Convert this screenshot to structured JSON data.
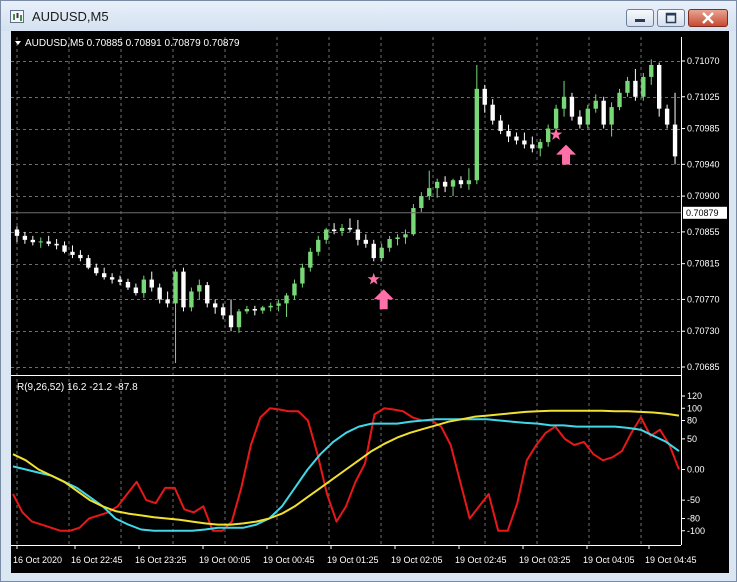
{
  "window": {
    "title": "AUDUSD,M5"
  },
  "main_chart": {
    "header": "AUDUSD,M5  0.70885 0.70891 0.70879 0.70879",
    "price_labels": [
      "0.71070",
      "0.71025",
      "0.70985",
      "0.70940",
      "0.70900",
      "0.70855",
      "0.70815",
      "0.70770",
      "0.70730",
      "0.70685"
    ],
    "current_price": "0.70879"
  },
  "indicator": {
    "header": "R(9,26,52) 16.2 -21.2 -87.8",
    "scale_labels": [
      "120",
      "100",
      "80",
      "50",
      "0.00",
      "-50",
      "-80",
      "-100"
    ]
  },
  "time_labels": [
    "16 Oct 2020",
    "16 Oct 22:45",
    "16 Oct 23:25",
    "19 Oct 00:05",
    "19 Oct 00:45",
    "19 Oct 01:25",
    "19 Oct 02:05",
    "19 Oct 02:45",
    "19 Oct 03:25",
    "19 Oct 04:05",
    "19 Oct 04:45"
  ],
  "colors": {
    "background": "#000000",
    "grid": "#6e6e6e",
    "bull": "#78d878",
    "bear": "#ffffff",
    "line_red": "#e81818",
    "line_cyan": "#40d8e8",
    "line_yellow": "#f0e030",
    "marker": "#ff6fa8"
  },
  "chart_data": {
    "type": "candlestick",
    "price_axis": {
      "min": 0.70685,
      "max": 0.7107
    },
    "candles": [
      {
        "o": 0.70858,
        "h": 0.70862,
        "l": 0.70842,
        "c": 0.7085
      },
      {
        "o": 0.7085,
        "h": 0.70855,
        "l": 0.7084,
        "c": 0.70845
      },
      {
        "o": 0.70845,
        "h": 0.7085,
        "l": 0.70838,
        "c": 0.70842
      },
      {
        "o": 0.70842,
        "h": 0.70848,
        "l": 0.70835,
        "c": 0.70843
      },
      {
        "o": 0.70843,
        "h": 0.7085,
        "l": 0.70837,
        "c": 0.7084
      },
      {
        "o": 0.7084,
        "h": 0.70846,
        "l": 0.70833,
        "c": 0.70838
      },
      {
        "o": 0.70838,
        "h": 0.70843,
        "l": 0.70828,
        "c": 0.7083
      },
      {
        "o": 0.7083,
        "h": 0.70838,
        "l": 0.70822,
        "c": 0.70826
      },
      {
        "o": 0.70826,
        "h": 0.70832,
        "l": 0.70818,
        "c": 0.70822
      },
      {
        "o": 0.70822,
        "h": 0.70826,
        "l": 0.70808,
        "c": 0.7081
      },
      {
        "o": 0.7081,
        "h": 0.70815,
        "l": 0.708,
        "c": 0.70803
      },
      {
        "o": 0.70803,
        "h": 0.7081,
        "l": 0.70795,
        "c": 0.70798
      },
      {
        "o": 0.70798,
        "h": 0.70803,
        "l": 0.7079,
        "c": 0.70795
      },
      {
        "o": 0.70795,
        "h": 0.708,
        "l": 0.70788,
        "c": 0.70792
      },
      {
        "o": 0.70792,
        "h": 0.70796,
        "l": 0.70782,
        "c": 0.70785
      },
      {
        "o": 0.70785,
        "h": 0.7079,
        "l": 0.70775,
        "c": 0.70778
      },
      {
        "o": 0.70778,
        "h": 0.708,
        "l": 0.70772,
        "c": 0.70795
      },
      {
        "o": 0.70795,
        "h": 0.70805,
        "l": 0.7078,
        "c": 0.70785
      },
      {
        "o": 0.70785,
        "h": 0.7079,
        "l": 0.70765,
        "c": 0.7077
      },
      {
        "o": 0.7077,
        "h": 0.7078,
        "l": 0.7076,
        "c": 0.70765
      },
      {
        "o": 0.70765,
        "h": 0.70808,
        "l": 0.7069,
        "c": 0.70805
      },
      {
        "o": 0.70805,
        "h": 0.7081,
        "l": 0.70755,
        "c": 0.7076
      },
      {
        "o": 0.7076,
        "h": 0.70785,
        "l": 0.70755,
        "c": 0.7078
      },
      {
        "o": 0.7078,
        "h": 0.70795,
        "l": 0.7077,
        "c": 0.70788
      },
      {
        "o": 0.70788,
        "h": 0.70792,
        "l": 0.7076,
        "c": 0.70765
      },
      {
        "o": 0.70765,
        "h": 0.7077,
        "l": 0.70752,
        "c": 0.7076
      },
      {
        "o": 0.7076,
        "h": 0.70765,
        "l": 0.70745,
        "c": 0.7075
      },
      {
        "o": 0.7075,
        "h": 0.7077,
        "l": 0.7073,
        "c": 0.70735
      },
      {
        "o": 0.70735,
        "h": 0.70758,
        "l": 0.70728,
        "c": 0.70755
      },
      {
        "o": 0.70755,
        "h": 0.70762,
        "l": 0.70752,
        "c": 0.70758
      },
      {
        "o": 0.70758,
        "h": 0.70762,
        "l": 0.7075,
        "c": 0.70756
      },
      {
        "o": 0.70756,
        "h": 0.70762,
        "l": 0.70752,
        "c": 0.7076
      },
      {
        "o": 0.7076,
        "h": 0.70766,
        "l": 0.70755,
        "c": 0.70762
      },
      {
        "o": 0.70762,
        "h": 0.7077,
        "l": 0.70755,
        "c": 0.70765
      },
      {
        "o": 0.70765,
        "h": 0.70778,
        "l": 0.70748,
        "c": 0.70775
      },
      {
        "o": 0.70775,
        "h": 0.70795,
        "l": 0.7077,
        "c": 0.7079
      },
      {
        "o": 0.7079,
        "h": 0.70815,
        "l": 0.70785,
        "c": 0.7081
      },
      {
        "o": 0.7081,
        "h": 0.70835,
        "l": 0.70805,
        "c": 0.7083
      },
      {
        "o": 0.7083,
        "h": 0.7085,
        "l": 0.70825,
        "c": 0.70845
      },
      {
        "o": 0.70845,
        "h": 0.7086,
        "l": 0.7084,
        "c": 0.70858
      },
      {
        "o": 0.70858,
        "h": 0.70866,
        "l": 0.70852,
        "c": 0.70856
      },
      {
        "o": 0.70856,
        "h": 0.70865,
        "l": 0.7085,
        "c": 0.7086
      },
      {
        "o": 0.7086,
        "h": 0.70872,
        "l": 0.70855,
        "c": 0.70858
      },
      {
        "o": 0.70858,
        "h": 0.7087,
        "l": 0.70838,
        "c": 0.70845
      },
      {
        "o": 0.70845,
        "h": 0.70852,
        "l": 0.70835,
        "c": 0.7084
      },
      {
        "o": 0.7084,
        "h": 0.70845,
        "l": 0.70818,
        "c": 0.70822
      },
      {
        "o": 0.70822,
        "h": 0.7084,
        "l": 0.70818,
        "c": 0.70835
      },
      {
        "o": 0.70835,
        "h": 0.7085,
        "l": 0.7083,
        "c": 0.70846
      },
      {
        "o": 0.70846,
        "h": 0.70852,
        "l": 0.70838,
        "c": 0.70848
      },
      {
        "o": 0.70848,
        "h": 0.70858,
        "l": 0.7084,
        "c": 0.70852
      },
      {
        "o": 0.70852,
        "h": 0.7089,
        "l": 0.7085,
        "c": 0.70885
      },
      {
        "o": 0.70885,
        "h": 0.70905,
        "l": 0.7088,
        "c": 0.709
      },
      {
        "o": 0.709,
        "h": 0.70932,
        "l": 0.70895,
        "c": 0.7091
      },
      {
        "o": 0.7091,
        "h": 0.70922,
        "l": 0.70898,
        "c": 0.70918
      },
      {
        "o": 0.70918,
        "h": 0.70925,
        "l": 0.70905,
        "c": 0.70912
      },
      {
        "o": 0.70912,
        "h": 0.70922,
        "l": 0.709,
        "c": 0.7092
      },
      {
        "o": 0.7092,
        "h": 0.70925,
        "l": 0.7091,
        "c": 0.70915
      },
      {
        "o": 0.70915,
        "h": 0.70935,
        "l": 0.70908,
        "c": 0.7092
      },
      {
        "o": 0.7092,
        "h": 0.71065,
        "l": 0.70915,
        "c": 0.71035
      },
      {
        "o": 0.71035,
        "h": 0.7104,
        "l": 0.71005,
        "c": 0.71015
      },
      {
        "o": 0.71015,
        "h": 0.71022,
        "l": 0.7099,
        "c": 0.70995
      },
      {
        "o": 0.70995,
        "h": 0.71002,
        "l": 0.70978,
        "c": 0.70982
      },
      {
        "o": 0.70982,
        "h": 0.7099,
        "l": 0.70968,
        "c": 0.70975
      },
      {
        "o": 0.70975,
        "h": 0.7098,
        "l": 0.70965,
        "c": 0.7097
      },
      {
        "o": 0.7097,
        "h": 0.7098,
        "l": 0.7096,
        "c": 0.70965
      },
      {
        "o": 0.70965,
        "h": 0.70975,
        "l": 0.70955,
        "c": 0.7096
      },
      {
        "o": 0.7096,
        "h": 0.70972,
        "l": 0.7095,
        "c": 0.70968
      },
      {
        "o": 0.70968,
        "h": 0.7099,
        "l": 0.70962,
        "c": 0.70985
      },
      {
        "o": 0.70985,
        "h": 0.71015,
        "l": 0.7098,
        "c": 0.7101
      },
      {
        "o": 0.7101,
        "h": 0.71045,
        "l": 0.71,
        "c": 0.71025
      },
      {
        "o": 0.71025,
        "h": 0.7103,
        "l": 0.70995,
        "c": 0.71
      },
      {
        "o": 0.71,
        "h": 0.71008,
        "l": 0.70985,
        "c": 0.7099
      },
      {
        "o": 0.7099,
        "h": 0.71015,
        "l": 0.70985,
        "c": 0.7101
      },
      {
        "o": 0.7101,
        "h": 0.71028,
        "l": 0.71005,
        "c": 0.7102
      },
      {
        "o": 0.7102,
        "h": 0.71025,
        "l": 0.70985,
        "c": 0.7099
      },
      {
        "o": 0.7099,
        "h": 0.71018,
        "l": 0.70975,
        "c": 0.71012
      },
      {
        "o": 0.71012,
        "h": 0.71035,
        "l": 0.71008,
        "c": 0.7103
      },
      {
        "o": 0.7103,
        "h": 0.7105,
        "l": 0.71025,
        "c": 0.71045
      },
      {
        "o": 0.71045,
        "h": 0.7106,
        "l": 0.7102,
        "c": 0.71025
      },
      {
        "o": 0.71025,
        "h": 0.71055,
        "l": 0.7102,
        "c": 0.7105
      },
      {
        "o": 0.7105,
        "h": 0.71072,
        "l": 0.7104,
        "c": 0.71065
      },
      {
        "o": 0.71065,
        "h": 0.71068,
        "l": 0.71,
        "c": 0.7101
      },
      {
        "o": 0.7101,
        "h": 0.71015,
        "l": 0.70985,
        "c": 0.7099
      },
      {
        "o": 0.7099,
        "h": 0.7103,
        "l": 0.7094,
        "c": 0.7095
      }
    ],
    "signals": [
      {
        "candle": 46
      },
      {
        "candle": 69
      }
    ],
    "oscillator": {
      "scale": {
        "min": -120,
        "max": 120
      },
      "series": [
        {
          "color": "red",
          "values": [
            -40,
            -70,
            -85,
            -90,
            -95,
            -100,
            -100,
            -95,
            -80,
            -75,
            -70,
            -60,
            -40,
            -20,
            -50,
            -55,
            -30,
            -30,
            -65,
            -70,
            -60,
            -100,
            -100,
            -85,
            -30,
            40,
            85,
            100,
            98,
            95,
            95,
            80,
            25,
            -40,
            -85,
            -60,
            -20,
            10,
            90,
            100,
            98,
            95,
            85,
            80,
            80,
            70,
            40,
            -20,
            -80,
            -60,
            -40,
            -100,
            -100,
            -55,
            15,
            40,
            60,
            70,
            50,
            40,
            45,
            25,
            15,
            20,
            30,
            60,
            85,
            55,
            65,
            40,
            0
          ]
        },
        {
          "color": "cyan",
          "values": [
            5,
            0,
            -5,
            -10,
            -20,
            -30,
            -45,
            -60,
            -80,
            -90,
            -98,
            -100,
            -100,
            -100,
            -100,
            -98,
            -95,
            -95,
            -95,
            -90,
            -80,
            -60,
            -30,
            0,
            25,
            45,
            60,
            70,
            75,
            75,
            75,
            78,
            80,
            82,
            82,
            82,
            82,
            82,
            80,
            78,
            76,
            75,
            72,
            72,
            70,
            70,
            70,
            70,
            68,
            65,
            55,
            45,
            30
          ]
        },
        {
          "color": "yellow",
          "values": [
            25,
            15,
            0,
            -10,
            -20,
            -35,
            -50,
            -60,
            -68,
            -72,
            -75,
            -78,
            -80,
            -82,
            -85,
            -88,
            -90,
            -90,
            -88,
            -85,
            -80,
            -72,
            -60,
            -45,
            -30,
            -15,
            0,
            15,
            30,
            42,
            52,
            60,
            66,
            72,
            78,
            82,
            86,
            88,
            90,
            92,
            94,
            95,
            96,
            96,
            96,
            96,
            96,
            95,
            95,
            94,
            93,
            91,
            88
          ]
        }
      ]
    }
  }
}
